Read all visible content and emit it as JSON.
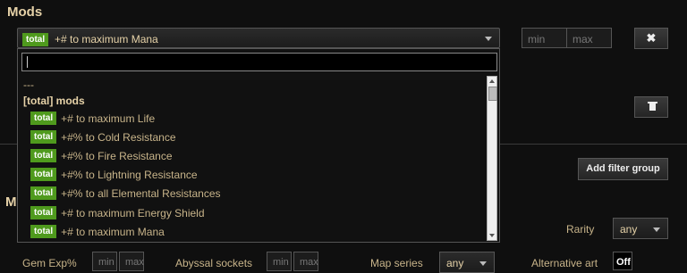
{
  "mods_title": "Mods",
  "mod_selector": {
    "badge": "total",
    "value": "+# to maximum Mana"
  },
  "min_placeholder": "min",
  "max_placeholder": "max",
  "remove_label": "✖",
  "add_filter_group": "Add filter group",
  "dropdown": {
    "dash": "---",
    "group_label": "[total] mods",
    "items": [
      {
        "badge": "total",
        "text": "+# to maximum Life"
      },
      {
        "badge": "total",
        "text": "+#% to Cold Resistance"
      },
      {
        "badge": "total",
        "text": "+#% to Fire Resistance"
      },
      {
        "badge": "total",
        "text": "+#% to Lightning Resistance"
      },
      {
        "badge": "total",
        "text": "+#% to all Elemental Resistances"
      },
      {
        "badge": "total",
        "text": "+# to maximum Energy Shield"
      },
      {
        "badge": "total",
        "text": "+# to maximum Mana"
      }
    ]
  },
  "misc_title": "M",
  "rarity": {
    "label": "Rarity",
    "value": "any"
  },
  "gem_exp": {
    "label": "Gem Exp%",
    "min": "min",
    "max": "max"
  },
  "abyssal": {
    "label": "Abyssal sockets",
    "min": "min",
    "max": "max"
  },
  "map_series": {
    "label": "Map series",
    "value": "any"
  },
  "alt_art": {
    "label": "Alternative art",
    "value": "Off"
  }
}
